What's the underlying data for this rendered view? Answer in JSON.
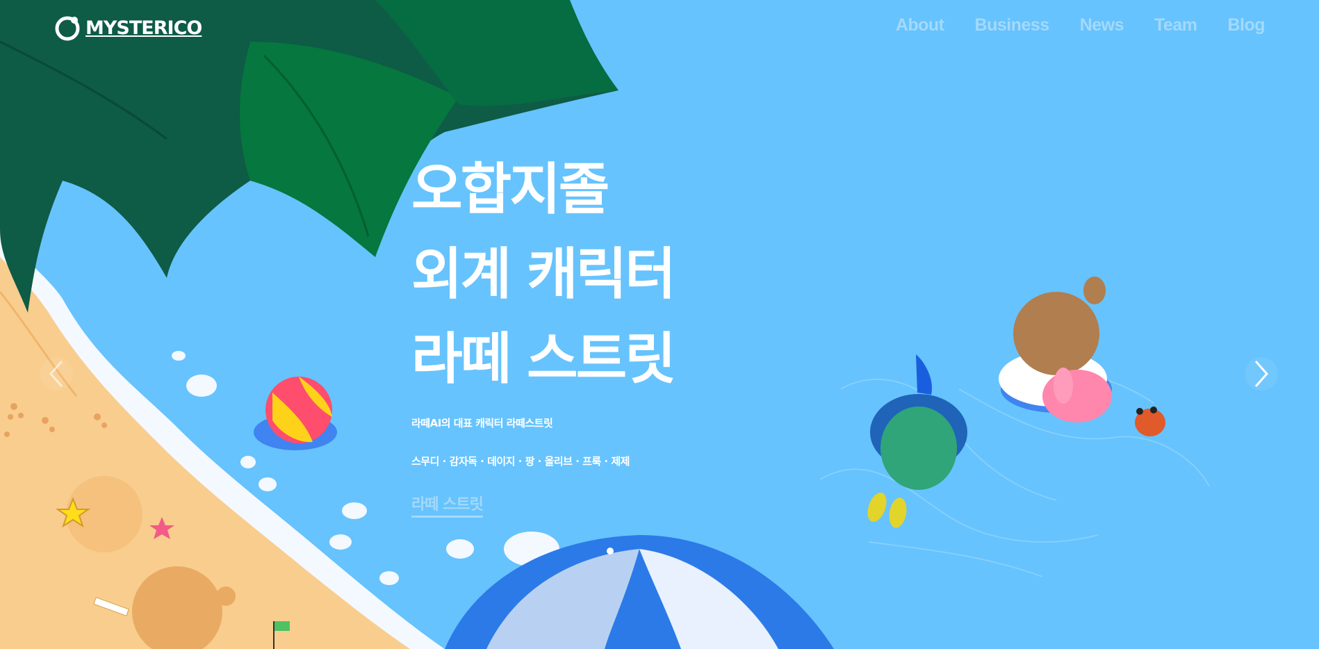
{
  "brand": {
    "logo_text": "MYSTERICO",
    "logo_icon": "mysterico-logo-icon"
  },
  "nav": {
    "items": [
      {
        "label": "About"
      },
      {
        "label": "Business"
      },
      {
        "label": "News"
      },
      {
        "label": "Team"
      },
      {
        "label": "Blog"
      }
    ]
  },
  "hero": {
    "title_lines": [
      "오합지졸",
      "외계 캐릭터",
      "라떼 스트릿"
    ],
    "subtitle": "라떼AI의 대표 캐릭터 라떼스트릿",
    "characters": "스무디 · 감자독 · 데이지 · 팡 · 올리브 · 프룩 · 제제",
    "cta_label": "라떼 스트릿"
  },
  "slider": {
    "prev_icon": "chevron-left-icon",
    "next_icon": "chevron-right-icon"
  },
  "colors": {
    "sky": "#66c3fd",
    "nav_text": "#a4d9fb",
    "sand": "#f9cd8e",
    "leaf_dark": "#0e5b46",
    "leaf_green": "#05773f"
  }
}
